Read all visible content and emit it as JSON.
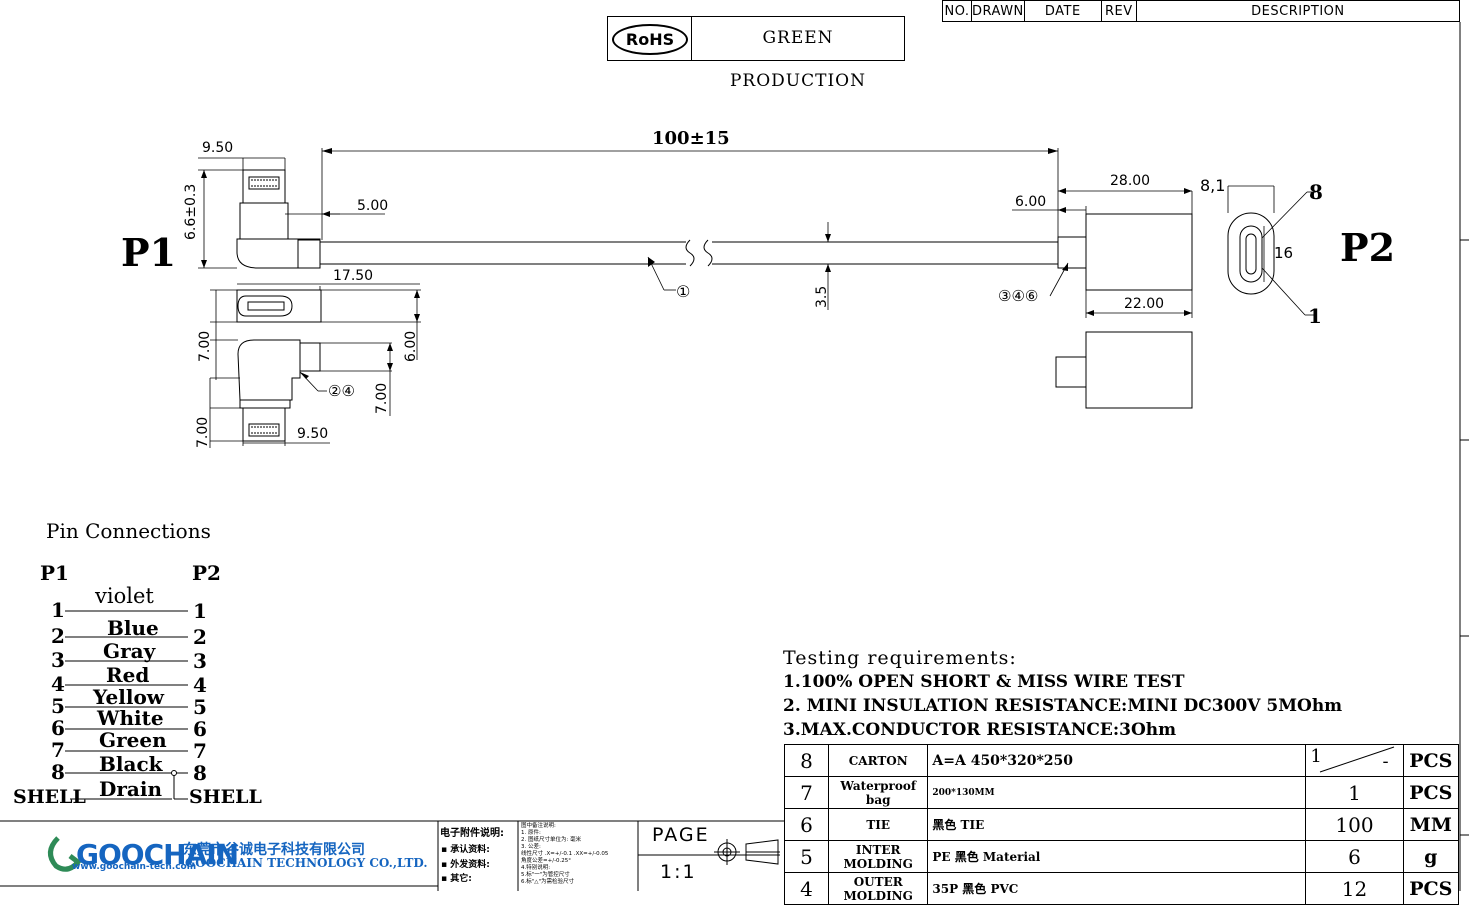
{
  "revision_table": {
    "no": "NO.",
    "drawn": "DRAWN",
    "date": "DATE",
    "rev": "REV",
    "description": "DESCRIPTION"
  },
  "rohs": {
    "logo": "RoHS",
    "text": "GREEN  PRODUCTION"
  },
  "labels": {
    "p1": "P1",
    "p2": "P2"
  },
  "dimensions": {
    "length": "100±15",
    "d_9_50_top": "9.50",
    "d_6_6": "6.6±0.3",
    "d_5_00": "5.00",
    "d_17_50": "17.50",
    "d_7_00_a": "7.00",
    "d_6_00_left": "6.00",
    "d_7_00_b": "7.00",
    "d_7_00_c": "7.00",
    "d_9_50_bottom": "9.50",
    "d_3_5": "3.5",
    "d_28_00": "28.00",
    "d_8_1": "8,1",
    "d_6_00_right": "6.00",
    "d_16": "16",
    "d_22_00": "22.00",
    "pin_8": "8",
    "pin_1": "1"
  },
  "callouts": {
    "c1": "①",
    "c24": "②④",
    "c346": "③④⑥"
  },
  "pin_connections": {
    "title": "Pin Connections",
    "p1_header": "P1",
    "p2_header": "P2",
    "rows": [
      {
        "left": "1",
        "color": "violet",
        "right": "1"
      },
      {
        "left": "2",
        "color": "Blue",
        "right": "2"
      },
      {
        "left": "3",
        "color": "Gray",
        "right": "3"
      },
      {
        "left": "4",
        "color": "Red",
        "right": "4"
      },
      {
        "left": "5",
        "color": "Yellow",
        "right": "5"
      },
      {
        "left": "6",
        "color": "White",
        "right": "6"
      },
      {
        "left": "7",
        "color": "Green",
        "right": "7"
      },
      {
        "left": "8",
        "color": "Black",
        "right": "8"
      },
      {
        "left": "SHELL",
        "color": "Drain",
        "right": "SHELL"
      }
    ]
  },
  "testing": {
    "title": "Testing requirements:",
    "items": [
      "1.100% OPEN SHORT & MISS WIRE TEST",
      "2. MINI INSULATION RESISTANCE:MINI DC300V 5MOhm",
      "3.MAX.CONDUCTOR RESISTANCE:3Ohm"
    ]
  },
  "bom": [
    {
      "no": "8",
      "name": "CARTON",
      "spec": "A=A 450*320*250",
      "qty": "1",
      "qty_extra": "-",
      "unit": "PCS"
    },
    {
      "no": "7",
      "name": "Waterproof bag",
      "spec": "200*130MM",
      "qty": "1",
      "qty_extra": "",
      "unit": "PCS"
    },
    {
      "no": "6",
      "name": "TIE",
      "spec": "黑色 TIE",
      "qty": "100",
      "qty_extra": "",
      "unit": "MM"
    },
    {
      "no": "5",
      "name": "INTER MOLDING",
      "spec": "PE 黑色  Material",
      "qty": "6",
      "qty_extra": "",
      "unit": "g"
    },
    {
      "no": "4",
      "name": "OUTER MOLDING",
      "spec": "35P 黑色 PVC",
      "qty": "12",
      "qty_extra": "",
      "unit": "PCS"
    }
  ],
  "title_block": {
    "logo": "GOOCHAIN",
    "website": "www.goochain-tech.com",
    "company_cn": "东莞市谷诚电子科技有限公司",
    "company_en": "GOOCHAIN TECHNOLOGY CO.,LTD.",
    "attach_title": "电子附件说明:",
    "attach_items": [
      "承认资料:",
      "外发资料:",
      "其它:"
    ],
    "notes": [
      "图中备注说明:",
      "1. 原件:",
      "2. 图纸尺寸单位为: 毫米",
      "3. 公差:",
      "线性尺寸 .X=+/-0.1   .XX=+/-0.05",
      "角度公差=+/-0.25°",
      "4.特别说明:",
      "5.标\"一\"为管控尺寸",
      "6.标\"△\"为需检验尺寸"
    ],
    "page_label": "PAGE",
    "scale": "1:1"
  },
  "colors": {
    "line": "#000000",
    "logo_blue": "#1565c0",
    "logo_green": "#2e8b57"
  }
}
